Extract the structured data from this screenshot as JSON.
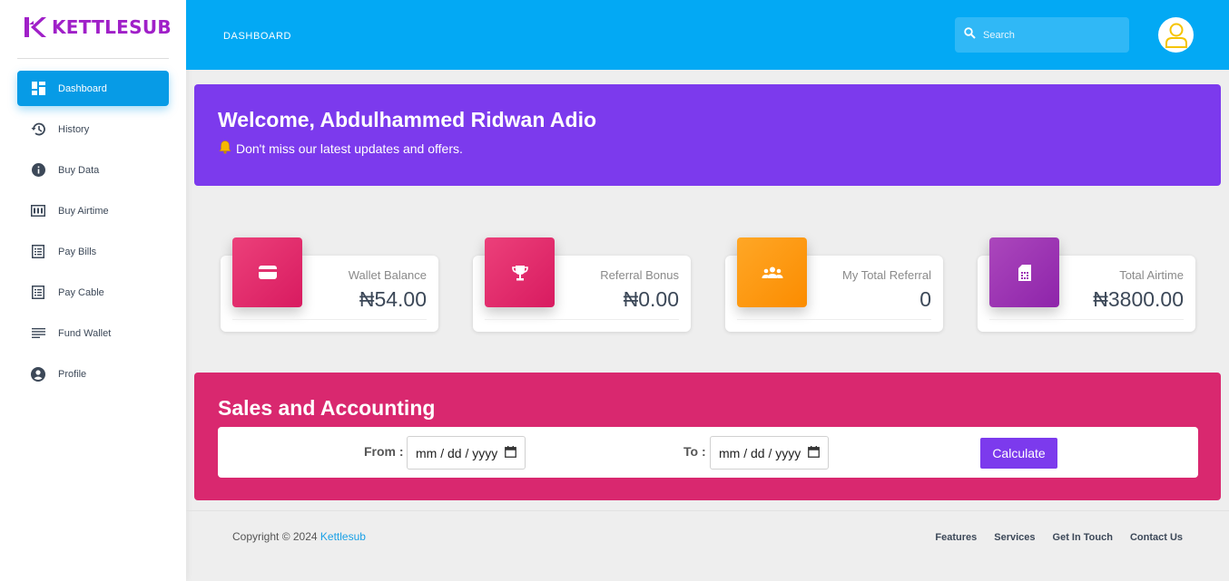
{
  "brand": {
    "name": "KETTLESUB",
    "color": "#a020c8"
  },
  "sidebar": {
    "items": [
      {
        "label": "Dashboard",
        "icon": "dashboard-icon",
        "active": true
      },
      {
        "label": "History",
        "icon": "history-icon"
      },
      {
        "label": "Buy Data",
        "icon": "info-icon"
      },
      {
        "label": "Buy Airtime",
        "icon": "dialpad-icon"
      },
      {
        "label": "Pay Bills",
        "icon": "list-icon"
      },
      {
        "label": "Pay Cable",
        "icon": "list-icon"
      },
      {
        "label": "Fund Wallet",
        "icon": "menu-lines-icon"
      },
      {
        "label": "Profile",
        "icon": "account-circle-icon"
      }
    ]
  },
  "topbar": {
    "title": "DASHBOARD",
    "search_placeholder": "Search",
    "color": "#03a9f4"
  },
  "welcome": {
    "title": "Welcome, Abdulhammed Ridwan Adio",
    "message": "Don't miss our latest updates and offers.",
    "icon": "bell-icon"
  },
  "cards": [
    {
      "label": "Wallet Balance",
      "value": "₦54.00",
      "icon": "wallet-icon",
      "color": "#d81b60"
    },
    {
      "label": "Referral Bonus",
      "value": "₦0.00",
      "icon": "trophy-icon",
      "color": "#d81b60"
    },
    {
      "label": "My Total Referral",
      "value": "0",
      "icon": "group-icon",
      "color": "#fb8c00"
    },
    {
      "label": "Total Airtime",
      "value": "₦3800.00",
      "icon": "sim-card-icon",
      "color": "#8e24aa"
    }
  ],
  "sales": {
    "title": "Sales and Accounting",
    "from_label": "From :",
    "to_label": "To :",
    "from_value": "mm / dd / yyyy",
    "to_value": "mm / dd / yyyy",
    "button": "Calculate"
  },
  "footer": {
    "copyright": "Copyright © 2024",
    "brand_link": "Kettlesub",
    "links": [
      "Features",
      "Services",
      "Get In Touch",
      "Contact Us"
    ]
  }
}
